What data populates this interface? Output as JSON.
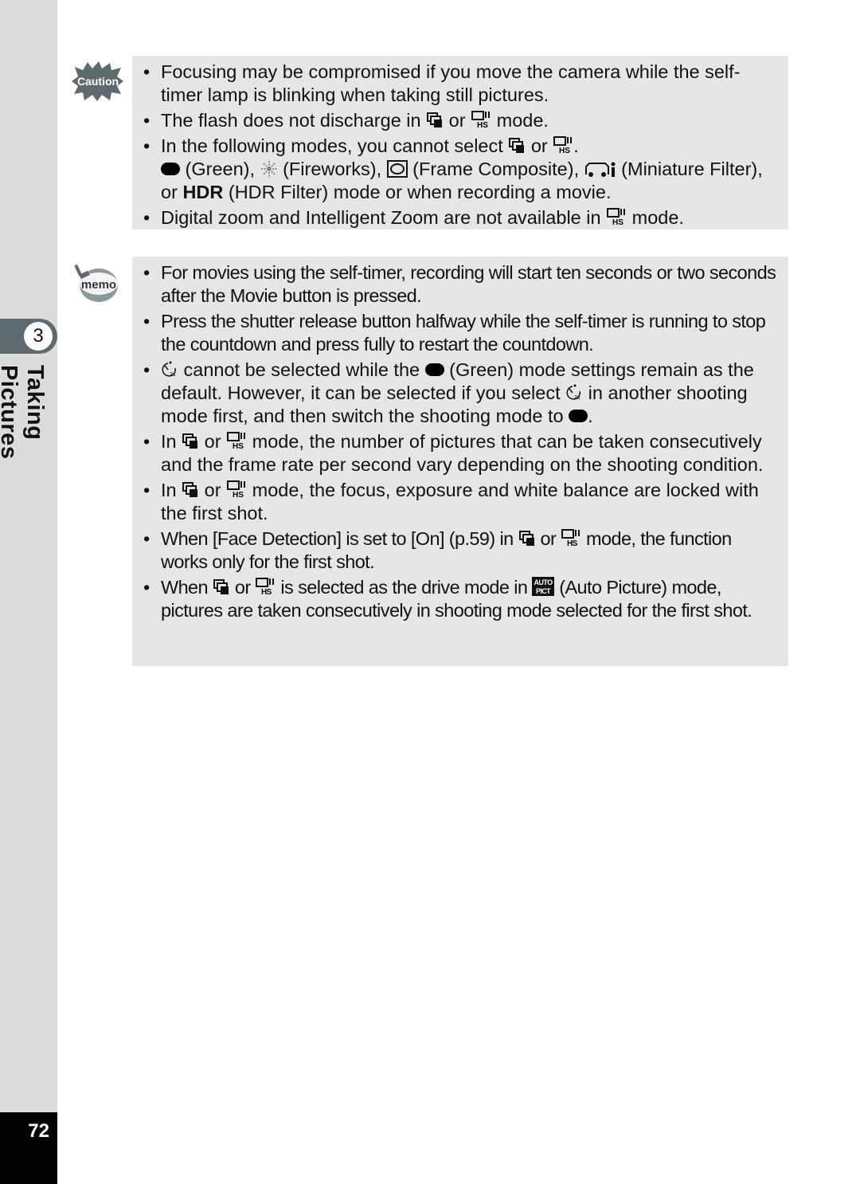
{
  "sidebar": {
    "chapter_number": "3",
    "chapter_title": "Taking Pictures",
    "page_number": "72"
  },
  "icons": {
    "caution_label": "Caution",
    "memo_label": "memo",
    "continuous": "continuous-shooting-icon",
    "burst_hs": "burst-shooting-hs-icon",
    "green_mode": "green-mode-icon",
    "fireworks": "fireworks-icon",
    "frame_composite": "frame-composite-icon",
    "miniature": "miniature-filter-icon",
    "hdr_label": "HDR",
    "self_timer_2s": "self-timer-2s-icon",
    "auto_picture": "auto-picture-icon"
  },
  "caution": {
    "items": [
      {
        "text": "Focusing may be compromised if you move the camera while the self-timer lamp is blinking when taking still pictures."
      },
      {
        "p1": "The flash does not discharge in ",
        "p2": " or ",
        "p3": " mode."
      },
      {
        "p1": "In the following modes, you cannot select ",
        "p2": " or ",
        "p3": ".",
        "p4": " (Green), ",
        "p5": " (Fireworks), ",
        "p6": " (Frame Composite), ",
        "p7": " (Miniature Filter), or ",
        "p8": " (HDR Filter) mode or when recording a movie."
      },
      {
        "p1": "Digital zoom and Intelligent Zoom are not available in ",
        "p2": " mode."
      }
    ]
  },
  "memo": {
    "items": [
      {
        "text": "For movies using the self-timer, recording will start ten seconds or two seconds after the Movie button is pressed."
      },
      {
        "text": "Press the shutter release button halfway while the self-timer is running to stop the countdown and press fully to restart the countdown."
      },
      {
        "p1": " cannot be selected while the ",
        "p2": " (Green) mode settings remain as the default. However, it can be selected if you select ",
        "p3": " in another shooting mode first, and then switch the shooting mode to ",
        "p4": "."
      },
      {
        "p1": "In ",
        "p2": " or ",
        "p3": " mode, the number of pictures that can be taken consecutively and the frame rate per second vary depending on the shooting condition."
      },
      {
        "p1": "In ",
        "p2": " or ",
        "p3": " mode, the focus, exposure and white balance are locked with the first shot."
      },
      {
        "p1": "When [Face Detection] is set to [On] (p.59) in ",
        "p2": " or ",
        "p3": " mode, the function works only for the first shot."
      },
      {
        "p1": "When ",
        "p2": " or ",
        "p3": " is selected as the drive mode in ",
        "p4": " (Auto Picture) mode, pictures are taken consecutively in shooting mode selected for the first shot."
      }
    ]
  }
}
